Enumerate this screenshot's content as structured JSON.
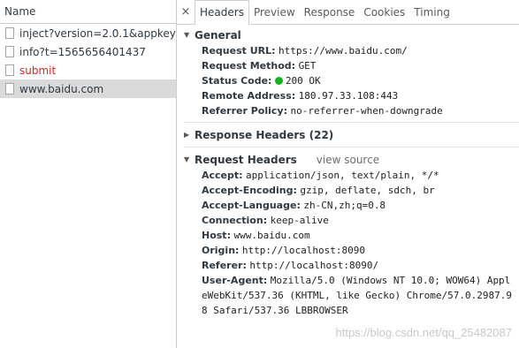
{
  "left_panel": {
    "header": "Name",
    "requests": [
      {
        "label": "inject?version=2.0.1&appkey=...",
        "status": "normal"
      },
      {
        "label": "info?t=1565656401437",
        "status": "normal"
      },
      {
        "label": "submit",
        "status": "error"
      },
      {
        "label": "www.baidu.com",
        "status": "selected"
      }
    ]
  },
  "tabs": {
    "close": "×",
    "items": [
      "Headers",
      "Preview",
      "Response",
      "Cookies",
      "Timing"
    ],
    "active": "Headers"
  },
  "general": {
    "title": "General",
    "request_url_label": "Request URL:",
    "request_url": "https://www.baidu.com/",
    "request_method_label": "Request Method:",
    "request_method": "GET",
    "status_code_label": "Status Code:",
    "status_code": "200 OK",
    "status_color": "#0eb31d",
    "remote_address_label": "Remote Address:",
    "remote_address": "180.97.33.108:443",
    "referrer_policy_label": "Referrer Policy:",
    "referrer_policy": "no-referrer-when-downgrade"
  },
  "response_headers": {
    "title": "Response Headers (22)"
  },
  "request_headers": {
    "title": "Request Headers",
    "view_source": "view source",
    "items": [
      {
        "k": "Accept:",
        "v": "application/json, text/plain, */*"
      },
      {
        "k": "Accept-Encoding:",
        "v": "gzip, deflate, sdch, br"
      },
      {
        "k": "Accept-Language:",
        "v": "zh-CN,zh;q=0.8"
      },
      {
        "k": "Connection:",
        "v": "keep-alive"
      },
      {
        "k": "Host:",
        "v": "www.baidu.com"
      },
      {
        "k": "Origin:",
        "v": "http://localhost:8090"
      },
      {
        "k": "Referer:",
        "v": "http://localhost:8090/"
      },
      {
        "k": "User-Agent:",
        "v": "Mozilla/5.0 (Windows NT 10.0; WOW64) AppleWebKit/537.36 (KHTML, like Gecko) Chrome/57.0.2987.98 Safari/537.36 LBBROWSER"
      }
    ]
  },
  "watermark": "https://blog.csdn.net/qq_25482087"
}
